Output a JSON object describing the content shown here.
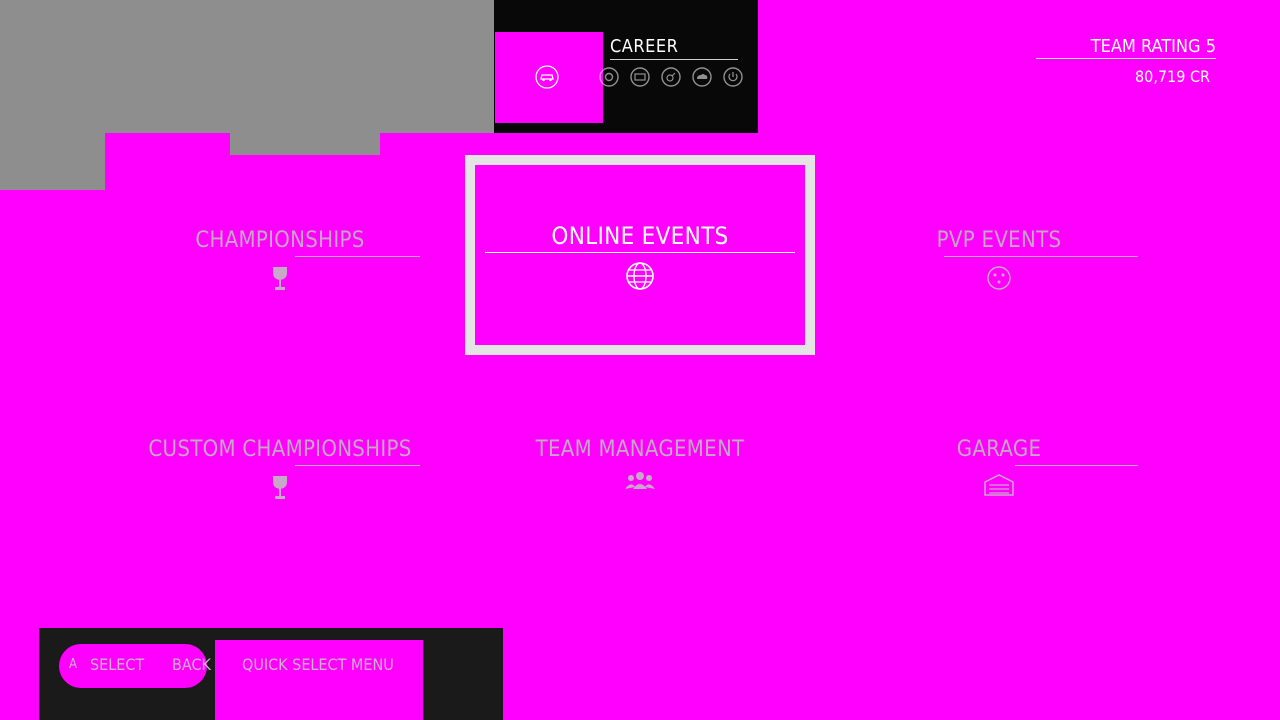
{
  "header": {
    "mode_title": "CAREER",
    "team_rating": "TEAM RATING 5",
    "credits": "80,719 CR",
    "mode_icons": [
      "car-icon",
      "wheel-icon",
      "id-card-icon",
      "tune-icon",
      "cloud-icon",
      "power-icon"
    ]
  },
  "menu": {
    "championships": "CHAMPIONSHIPS",
    "online_events": "ONLINE EVENTS",
    "pvp_events": "PVP EVENTS",
    "custom_championships": "CUSTOM CHAMPIONSHIPS",
    "team_management": "TEAM MANAGEMENT",
    "garage": "GARAGE",
    "selected": "ONLINE EVENTS"
  },
  "footer": {
    "a_key": "A",
    "select": "SELECT",
    "back": "BACK",
    "quick_select": "QUICK SELECT MENU"
  },
  "colors": {
    "background": "#ff00ff",
    "highlight_border": "#e4e4e4",
    "text_active": "#ffffff",
    "text_inactive": "#c3a7c3"
  }
}
